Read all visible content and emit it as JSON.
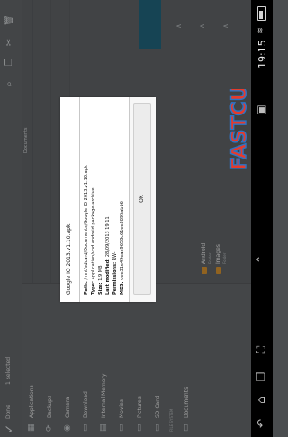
{
  "action_bar": {
    "done_label": "Done",
    "selected_label": "1 selected"
  },
  "sidebar": {
    "sections": [
      {
        "label": "Applications"
      },
      {
        "label": "Backups"
      },
      {
        "label": "Camera"
      },
      {
        "label": "Download"
      },
      {
        "label": "Internal Memory"
      },
      {
        "label": "Movies"
      },
      {
        "label": "Pictures"
      },
      {
        "label": "SD Card"
      },
      {
        "label": "Documents"
      }
    ],
    "section_headers": [
      "LOCAL STORAGE",
      "FILE SYSTEM"
    ]
  },
  "main": {
    "header_label": "Documents",
    "folders": [
      {
        "name": "Android",
        "sub": "Folder"
      },
      {
        "name": "Images",
        "sub": "Folder"
      }
    ]
  },
  "dialog": {
    "title": "Google IO 2013.v1.10.apk",
    "path_label": "Path:",
    "path_value": "/mnt/sdcard/Documents/Google IO 2013.v1.10.apk",
    "type_label": "Type:",
    "type_value": "application/vnd.android.package-archive",
    "size_label": "Size:",
    "size_value": "1.9 MB",
    "modified_label": "Last modified:",
    "modified_value": "28/09/2013 19:11",
    "permissions_label": "Permissions:",
    "permissions_value": "RW-",
    "md5_label": "MD5:",
    "md5_value": "dee31e49eaa9658c61ee3895abb6",
    "ok_label": "OK"
  },
  "logo_text": "FASTCUP",
  "status": {
    "time": "19:15"
  },
  "icons": [
    "check-icon",
    "search-icon",
    "copy-icon",
    "cut-icon",
    "delete-icon",
    "folder-icon",
    "back-icon",
    "home-icon",
    "recents-icon",
    "screenshot-icon",
    "wifi-icon",
    "battery-icon",
    "chevron-up-icon"
  ],
  "colors": {
    "accent_blue": "#1f5f75",
    "folder_orange": "#c98a2d",
    "dialog_bg": "#ffffff",
    "logo_red": "#e53b2c",
    "logo_blue": "#2b74c7"
  }
}
